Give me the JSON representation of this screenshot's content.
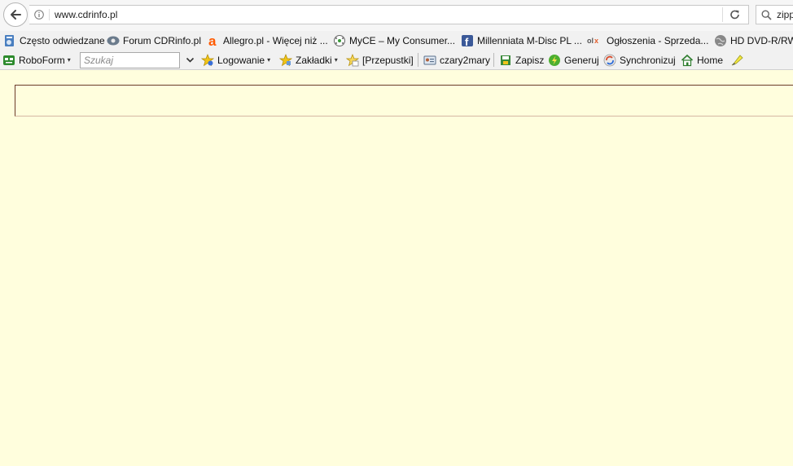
{
  "browser": {
    "url": "www.cdrinfo.pl",
    "search_text": "zipp"
  },
  "bookmarks": [
    {
      "label": "Często odwiedzane",
      "icon": "bookmarks-folder-icon"
    },
    {
      "label": "Forum CDRinfo.pl",
      "icon": "cdrinfo-icon"
    },
    {
      "label": "Allegro.pl - Więcej niż ...",
      "icon": "allegro-icon"
    },
    {
      "label": "MyCE – My Consumer...",
      "icon": "myce-icon"
    },
    {
      "label": "Millenniata M-Disc PL ...",
      "icon": "facebook-icon"
    },
    {
      "label": "Ogłoszenia - Sprzeda...",
      "icon": "olx-icon"
    },
    {
      "label": "HD DVD-R/RW",
      "icon": "globe-icon"
    }
  ],
  "roboform": {
    "menu_label": "RoboForm",
    "search_placeholder": "Szukaj",
    "items": [
      {
        "label": "Logowanie",
        "icon": "star-login-icon"
      },
      {
        "label": "Zakładki",
        "icon": "star-bookmarks-icon"
      },
      {
        "label": "[Przepustki]",
        "icon": "star-passes-icon"
      },
      {
        "label": "czary2mary",
        "icon": "identity-card-icon"
      },
      {
        "label": "Zapisz",
        "icon": "save-icon"
      },
      {
        "label": "Generuj",
        "icon": "generate-icon"
      },
      {
        "label": "Synchronizuj",
        "icon": "sync-icon"
      },
      {
        "label": "Home",
        "icon": "home-icon"
      }
    ]
  },
  "colors": {
    "page_background": "#fffedd",
    "toolbar_background": "#f1f1f1",
    "box_border": "#6b3b2b"
  }
}
